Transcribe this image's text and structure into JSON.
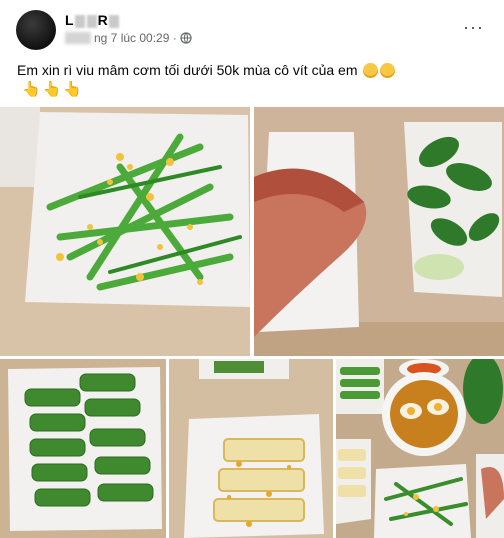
{
  "post": {
    "author_name_visible": "L R",
    "timestamp": "ng 7 lúc 00:29 ·",
    "caption": "Em xin rì viu mâm cơm tối  dưới 50k mùa cô vít của em",
    "emoji_caption": "😄😄",
    "hands": "👆👆👆",
    "more": "···"
  },
  "photos": [
    {
      "desc": "water spinach with garlic"
    },
    {
      "desc": "fried fish and herbs"
    },
    {
      "desc": "sliced cucumbers"
    },
    {
      "desc": "fried tofu slices"
    },
    {
      "desc": "meal tray"
    }
  ],
  "icons": {
    "privacy": "globe-icon",
    "more": "more-options-icon"
  }
}
